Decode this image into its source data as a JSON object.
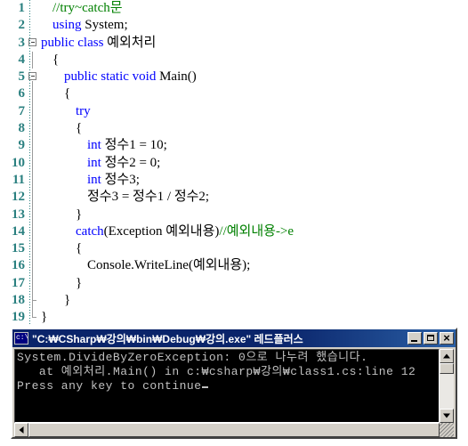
{
  "editor": {
    "name": "code-editor",
    "language": "csharp",
    "colors": {
      "keyword": "#0000ff",
      "comment": "#008000",
      "text": "#000000",
      "linenumber": "#2b8080",
      "background": "#ffffff"
    },
    "lines": [
      {
        "n": "1",
        "outline": "none",
        "indent": 1,
        "segments": [
          {
            "t": "//try~catch문",
            "c": "cmt"
          }
        ]
      },
      {
        "n": "2",
        "outline": "none",
        "indent": 1,
        "segments": [
          {
            "t": "using ",
            "c": "kw"
          },
          {
            "t": "System;",
            "c": "txt"
          }
        ]
      },
      {
        "n": "3",
        "outline": "collapse",
        "indent": 0,
        "segments": [
          {
            "t": "public class ",
            "c": "kw"
          },
          {
            "t": "예외처리",
            "c": "txt"
          }
        ]
      },
      {
        "n": "4",
        "outline": "line",
        "indent": 1,
        "segments": [
          {
            "t": "{",
            "c": "txt"
          }
        ]
      },
      {
        "n": "5",
        "outline": "collapse",
        "indent": 2,
        "segments": [
          {
            "t": "public static void ",
            "c": "kw"
          },
          {
            "t": "Main()",
            "c": "txt"
          }
        ]
      },
      {
        "n": "6",
        "outline": "line",
        "indent": 2,
        "segments": [
          {
            "t": "{",
            "c": "txt"
          }
        ]
      },
      {
        "n": "7",
        "outline": "line",
        "indent": 3,
        "segments": [
          {
            "t": "try",
            "c": "kw"
          }
        ]
      },
      {
        "n": "8",
        "outline": "line",
        "indent": 3,
        "segments": [
          {
            "t": "{",
            "c": "txt"
          }
        ]
      },
      {
        "n": "9",
        "outline": "line",
        "indent": 4,
        "segments": [
          {
            "t": "int ",
            "c": "kw"
          },
          {
            "t": "정수1 = 10;",
            "c": "txt"
          }
        ]
      },
      {
        "n": "10",
        "outline": "line",
        "indent": 4,
        "segments": [
          {
            "t": "int ",
            "c": "kw"
          },
          {
            "t": "정수2 = 0;",
            "c": "txt"
          }
        ]
      },
      {
        "n": "11",
        "outline": "line",
        "indent": 4,
        "segments": [
          {
            "t": "int ",
            "c": "kw"
          },
          {
            "t": "정수3;",
            "c": "txt"
          }
        ]
      },
      {
        "n": "12",
        "outline": "line",
        "indent": 4,
        "segments": [
          {
            "t": "정수3 = 정수1 / 정수2;",
            "c": "txt"
          }
        ]
      },
      {
        "n": "13",
        "outline": "line",
        "indent": 3,
        "segments": [
          {
            "t": "}",
            "c": "txt"
          }
        ]
      },
      {
        "n": "14",
        "outline": "line",
        "indent": 3,
        "segments": [
          {
            "t": "catch",
            "c": "kw"
          },
          {
            "t": "(Exception 예외내용)",
            "c": "txt"
          },
          {
            "t": "//예외내용->e",
            "c": "cmt"
          }
        ]
      },
      {
        "n": "15",
        "outline": "line",
        "indent": 3,
        "segments": [
          {
            "t": "{",
            "c": "txt"
          }
        ]
      },
      {
        "n": "16",
        "outline": "line",
        "indent": 4,
        "segments": [
          {
            "t": "Console.WriteLine(예외내용);",
            "c": "txt"
          }
        ]
      },
      {
        "n": "17",
        "outline": "line",
        "indent": 3,
        "segments": [
          {
            "t": "}",
            "c": "txt"
          }
        ]
      },
      {
        "n": "18",
        "outline": "endtick",
        "indent": 2,
        "segments": [
          {
            "t": "}",
            "c": "txt"
          }
        ]
      },
      {
        "n": "19",
        "outline": "endcorner",
        "indent": 0,
        "segments": [
          {
            "t": "}",
            "c": "txt"
          }
        ]
      }
    ]
  },
  "console": {
    "name": "console-window",
    "title": "\"C:₩CSharp₩강의₩bin₩Debug₩강의.exe\" 레드플러스",
    "icon": "console-app-icon",
    "buttons": {
      "minimize": "minimize-button",
      "maximize": "maximize-button",
      "close": "close-button"
    },
    "output": [
      "System.DivideByZeroException: 0으로 나누려 했습니다.",
      "   at 예외처리.Main() in c:₩csharp₩강의₩class1.cs:line 12",
      "Press any key to continue"
    ],
    "colors": {
      "background": "#000000",
      "foreground": "#c0c0c0",
      "titlebar": "#0a246a",
      "chrome": "#d4d0c8"
    }
  }
}
